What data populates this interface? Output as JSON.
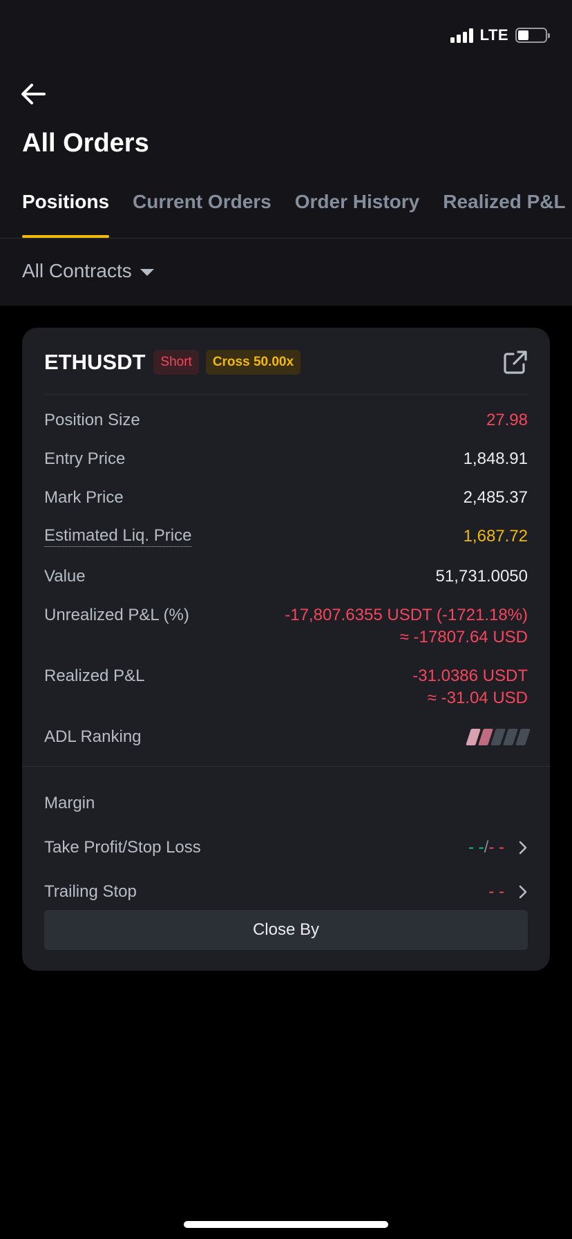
{
  "status_bar": {
    "network": "LTE",
    "battery_level": 0.4
  },
  "header": {
    "title": "All Orders"
  },
  "tabs": [
    {
      "label": "Positions",
      "active": true
    },
    {
      "label": "Current Orders",
      "active": false
    },
    {
      "label": "Order History",
      "active": false
    },
    {
      "label": "Realized P&L",
      "active": false
    }
  ],
  "filter": {
    "label": "All Contracts"
  },
  "position": {
    "symbol": "ETHUSDT",
    "side": "Short",
    "margin_mode": "Cross 50.00x",
    "fields": {
      "position_size": {
        "label": "Position Size",
        "value": "27.98"
      },
      "entry_price": {
        "label": "Entry Price",
        "value": "1,848.91"
      },
      "mark_price": {
        "label": "Mark Price",
        "value": "2,485.37"
      },
      "liq_price": {
        "label": "Estimated Liq. Price",
        "value": "1,687.72"
      },
      "value": {
        "label": "Value",
        "value": "51,731.0050"
      },
      "unrealized_pnl": {
        "label": "Unrealized P&L (%)",
        "value": "-17,807.6355 USDT (-1721.18%)",
        "usd": "≈ -17807.64 USD"
      },
      "realized_pnl": {
        "label": "Realized P&L",
        "value": "-31.0386 USDT",
        "usd": "≈ -31.04 USD"
      },
      "adl": {
        "label": "ADL Ranking",
        "level": 2,
        "max": 5
      }
    },
    "margin_label": "Margin",
    "tpsl": {
      "label": "Take Profit/Stop Loss",
      "tp": "- -",
      "sep": "/",
      "sl": "- -"
    },
    "trailing": {
      "label": "Trailing Stop",
      "value": "- -"
    },
    "close_button": "Close By"
  },
  "colors": {
    "accent": "#f0b90b",
    "sell": "#f6465d",
    "buy": "#0ecb81",
    "background": "#141419",
    "card": "#1e1f24"
  }
}
